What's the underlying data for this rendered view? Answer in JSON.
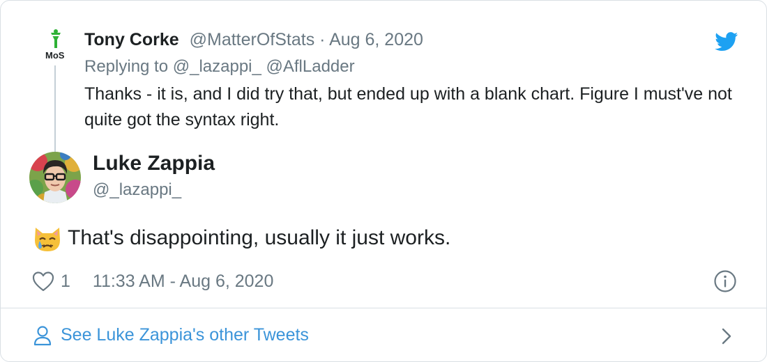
{
  "parent_tweet": {
    "avatar_text": "MoS",
    "author_name": "Tony Corke",
    "handle": "@MatterOfStats",
    "separator": " · ",
    "date": "Aug 6, 2020",
    "replying_to": "Replying to @_lazappi_ @AflLadder",
    "text": "Thanks - it is, and I did try that, but ended up with a blank chart. Figure I must've not quite got the syntax right."
  },
  "main_tweet": {
    "author_name": "Luke Zappia",
    "handle": "@_lazappi_",
    "emoji": "crying-cat-face",
    "text": "That's disappointing, usually it just works.",
    "like_count": "1",
    "timestamp": "11:33 AM - Aug 6, 2020"
  },
  "footer": {
    "see_more_label": "See Luke Zappia's other Tweets"
  },
  "icons": {
    "brand": "twitter-bird-icon",
    "like": "heart-icon",
    "info": "info-icon",
    "person": "person-icon",
    "chevron": "chevron-right-icon"
  },
  "colors": {
    "twitter_blue": "#1da1f2",
    "link_blue": "#3b94d9",
    "secondary_text": "#697882",
    "primary_text": "#1c2022",
    "border": "#d9dfe4"
  }
}
